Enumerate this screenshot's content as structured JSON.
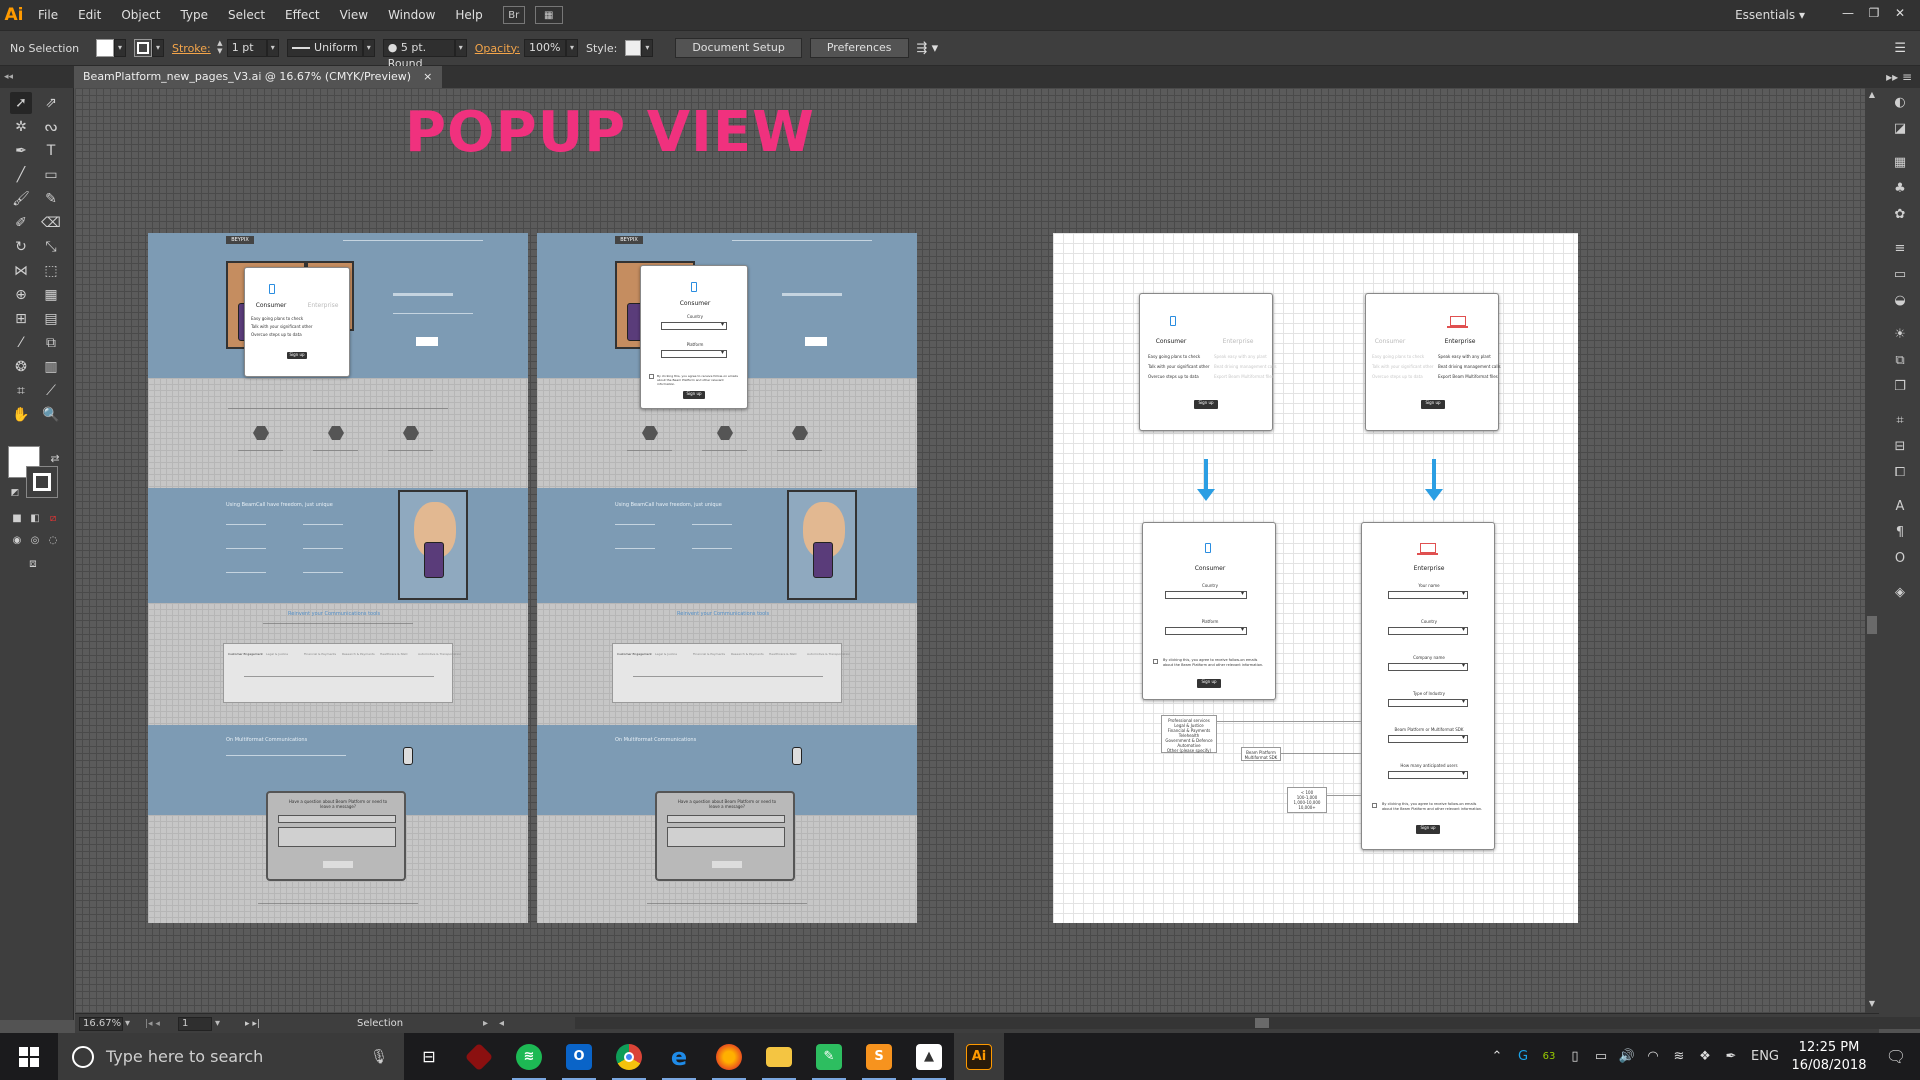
{
  "app": {
    "logo_text": "Ai",
    "workspace": "Essentials"
  },
  "menu": [
    "File",
    "Edit",
    "Object",
    "Type",
    "Select",
    "Effect",
    "View",
    "Window",
    "Help"
  ],
  "menu_icons": [
    "Br",
    "▦"
  ],
  "window_buttons": [
    "—",
    "❐",
    "✕"
  ],
  "control_bar": {
    "selection": "No Selection",
    "stroke_label": "Stroke:",
    "stroke_weight": "1 pt",
    "profile": "Uniform",
    "brush": "5 pt. Round",
    "opacity_label": "Opacity:",
    "opacity_value": "100%",
    "style_label": "Style:",
    "document_setup": "Document Setup",
    "preferences": "Preferences"
  },
  "document_tab": {
    "title": "BeamPlatform_new_pages_V3.ai @ 16.67% (CMYK/Preview)",
    "close": "×"
  },
  "canvas": {
    "heading": "POPUP VIEW",
    "heading_color": "#f0317e"
  },
  "popups": {
    "consumer": {
      "title": "Consumer",
      "items": [
        "Easy going plans to check",
        "Talk with your significant other",
        "Overcue steps up to data"
      ],
      "button": "Sign up",
      "country_label": "Country",
      "platform_label": "Platform",
      "checkbox_text": "By clicking this, you agree to receive follow-on emails about the Beam Platform and other relevant information."
    },
    "enterprise": {
      "title": "Enterprise",
      "items": [
        "Speak easy with any plant",
        "Beat driving management calls",
        "Export Beam Multiformat files"
      ],
      "button": "Sign up",
      "fields": [
        "Your name",
        "Country",
        "Company name",
        "Type of Industry",
        "Beam Platform or Multiformat SDK",
        "How many anticipated users"
      ]
    },
    "notes": {
      "industries": "Professional services\nLegal & Justice\nFinancial & Payments\nTelehealth\nGovernment & Defence\nAutomotive\nOther (please specify)",
      "platform_sdk": "Beam Platform\nMultiformat SDK",
      "users": "< 100\n100-1,000\n1,000-10,000\n10,000+"
    }
  },
  "artboard_texts": {
    "section_heading_1": "Using BeamCall have freedom, just unique",
    "section_heading_2": "Reinvent your Communications tools",
    "section_heading_3": "On Multiformat Communications",
    "contact_heading": "Have a question about Beam Platform or need to leave a message?",
    "tabs": [
      "Customer Engagement",
      "Legal & Justice",
      "Financial & Payments",
      "Research & Payments",
      "Healthcare & NGO",
      "Automotive & Transportation"
    ]
  },
  "status_bar": {
    "zoom": "16.67%",
    "artboard": "1",
    "tool": "Selection"
  },
  "taskbar": {
    "search_placeholder": "Type here to search",
    "apps": [
      "task-view",
      "red-app",
      "spotify",
      "outlook",
      "chrome",
      "edge",
      "firefox",
      "file-explorer",
      "evernote",
      "sublime-text",
      "photos",
      "illustrator"
    ],
    "tray": {
      "badge": "63",
      "language": "ENG",
      "time": "12:25 PM",
      "date": "16/08/2018"
    }
  }
}
